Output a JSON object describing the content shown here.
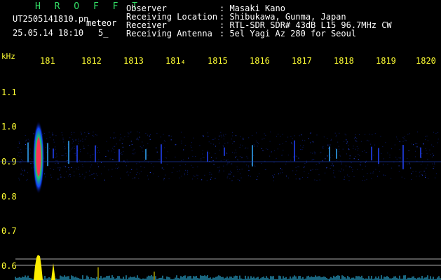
{
  "header": {
    "brand": "H R O F F T",
    "file_name": "UT2505141810.pn",
    "file_suffix": "meteor",
    "datetime": "25.05.14 18:10",
    "page_indicator": "5_",
    "fields": [
      {
        "label": "Observer",
        "value": ": Masaki Kano"
      },
      {
        "label": "Receiving Location",
        "value": ": Shibukawa, Gunma, Japan"
      },
      {
        "label": "Receiver",
        "value": ": RTL-SDR SDR# 43dB L15 96.7MHz CW"
      },
      {
        "label": "Receiving Antenna",
        "value": ": 5el Yagi Az 280 for Seoul"
      }
    ]
  },
  "axes": {
    "y_unit": "kHz",
    "x_ticks": [
      "181",
      "1812",
      "1813",
      "181₄",
      "1815",
      "1816",
      "1817",
      "1818",
      "1819",
      "1820"
    ],
    "y_ticks": [
      "1.1",
      "1.0",
      "0.9",
      "0.8",
      "0.7",
      "0.6"
    ]
  },
  "colors": {
    "tick": "#ffff33",
    "brand": "#33dd66",
    "meteor_core": "#ff2266",
    "signal_line": "#3355ff",
    "amplitude_peak": "#ffee00",
    "amplitude_baseline": "#33ccff"
  }
}
